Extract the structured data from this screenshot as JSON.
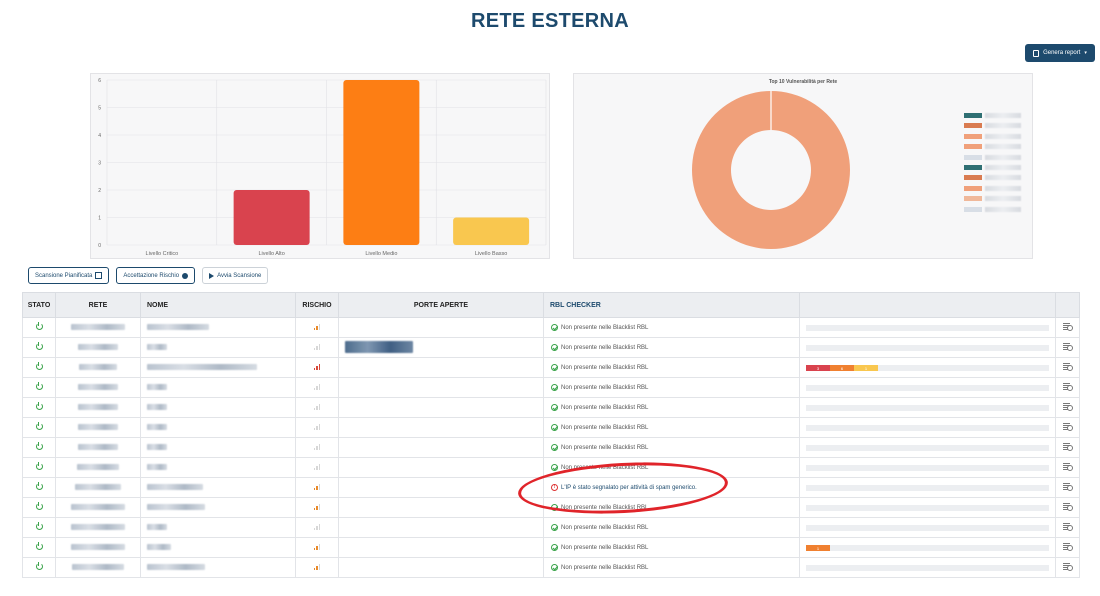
{
  "page": {
    "title": "RETE ESTERNA"
  },
  "report_button": {
    "label": "Genera report"
  },
  "charts": {
    "bar": {
      "type": "bar",
      "categories": [
        "Livello Critico",
        "Livello Alto",
        "Livello Medio",
        "Livello Basso"
      ],
      "values": [
        0,
        2,
        6,
        1
      ],
      "ylim": [
        0,
        6
      ],
      "yticks": [
        0,
        1,
        2,
        3,
        4,
        5,
        6
      ],
      "colors": [
        "#d9434e",
        "#d9434e",
        "#fd7e14",
        "#f9c74f"
      ],
      "grid": true
    },
    "donut": {
      "type": "pie",
      "title": "Top 10 Vulnerabilità per Rete",
      "values": [
        100
      ],
      "color": "#f0a07a",
      "legend_placement": "right",
      "legend_colors": [
        "#2f6f73",
        "#d97b50",
        "#f0a07a",
        "#f0a07a",
        "#d8dee6",
        "#2f6f73",
        "#d97b50",
        "#f0a07a",
        "#f0b89a",
        "#d8dee6"
      ]
    }
  },
  "actions": {
    "scheduled_scan": "Scansione Pianificata",
    "risk_acceptance": "Accettazione Rischio",
    "start_scan": "Avvia Scansione"
  },
  "table": {
    "headers": {
      "stato": "STATO",
      "rete": "RETE",
      "nome": "NOME",
      "rischio": "RISCHIO",
      "porte": "PORTE APERTE",
      "rbl": "RBL CHECKER",
      "extra": "",
      "action": ""
    },
    "rows": [
      {
        "risk": 2,
        "rbl": "Non presente nelle Blacklist RBL",
        "alert": false,
        "ports": false,
        "segments": []
      },
      {
        "risk": 0,
        "rbl": "Non presente nelle Blacklist RBL",
        "alert": false,
        "ports": true,
        "segments": []
      },
      {
        "risk": 3,
        "rbl": "Non presente nelle Blacklist RBL",
        "alert": false,
        "ports": false,
        "segments": [
          {
            "label": "3",
            "color": "#d9434e"
          },
          {
            "label": "6",
            "color": "#f08030"
          },
          {
            "label": "1",
            "color": "#f9c74f"
          }
        ]
      },
      {
        "risk": 0,
        "rbl": "Non presente nelle Blacklist RBL",
        "alert": false,
        "ports": false,
        "segments": []
      },
      {
        "risk": 0,
        "rbl": "Non presente nelle Blacklist RBL",
        "alert": false,
        "ports": false,
        "segments": []
      },
      {
        "risk": 0,
        "rbl": "Non presente nelle Blacklist RBL",
        "alert": false,
        "ports": false,
        "segments": []
      },
      {
        "risk": 0,
        "rbl": "Non presente nelle Blacklist RBL",
        "alert": false,
        "ports": false,
        "segments": []
      },
      {
        "risk": 0,
        "rbl": "Non presente nelle Blacklist RBL",
        "alert": false,
        "ports": false,
        "segments": []
      },
      {
        "risk": 2,
        "rbl": "L'IP è stato segnalato per attività di spam generico.",
        "alert": true,
        "ports": false,
        "segments": []
      },
      {
        "risk": 2,
        "rbl": "Non presente nelle Blacklist RBL",
        "alert": false,
        "ports": false,
        "segments": []
      },
      {
        "risk": 0,
        "rbl": "Non presente nelle Blacklist RBL",
        "alert": false,
        "ports": false,
        "segments": []
      },
      {
        "risk": 2,
        "rbl": "Non presente nelle Blacklist RBL",
        "alert": false,
        "ports": false,
        "segments": [
          {
            "label": "1",
            "color": "#f08030"
          }
        ]
      },
      {
        "risk": 2,
        "rbl": "Non presente nelle Blacklist RBL",
        "alert": false,
        "ports": false,
        "segments": []
      }
    ]
  },
  "colors": {
    "accent": "#1d4a6d",
    "ok": "#3aa34a",
    "alert": "#e0242a"
  }
}
